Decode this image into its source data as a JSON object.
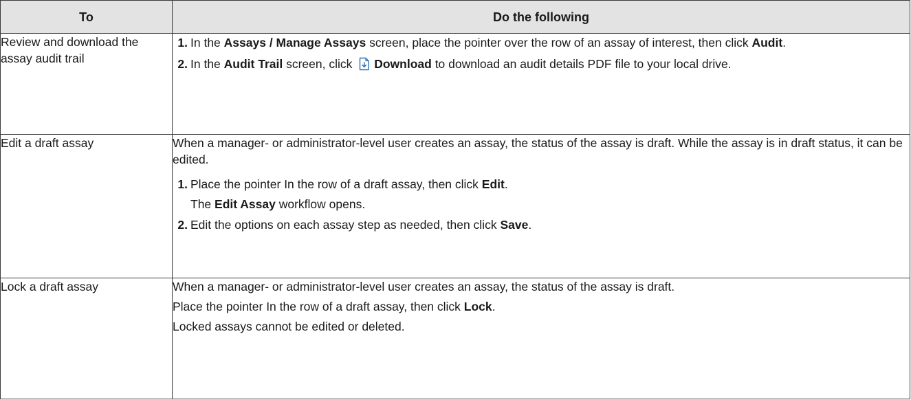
{
  "header": {
    "col1": "To",
    "col2": "Do the following"
  },
  "rows": [
    {
      "to": "Review and download the assay audit trail",
      "steps": [
        {
          "num": "1.",
          "t1": "In the ",
          "b1": "Assays / Manage Assays",
          "t2": " screen, place the pointer over the row of an assay of interest, then click ",
          "b2": "Audit",
          "t3": "."
        },
        {
          "num": "2.",
          "t1": "In the ",
          "b1": "Audit Trail",
          "t2": " screen, click ",
          "icon": "download-file-icon",
          "b2": "Download",
          "t3": " to download an audit details PDF file to your local drive."
        }
      ]
    },
    {
      "to": "Edit a draft assay",
      "intro": "When a manager- or administrator-level user creates an assay, the status of the assay is draft. While the assay is in draft status, it can be edited.",
      "steps": [
        {
          "num": "1.",
          "t1": "Place the pointer In the row of a draft assay, then click ",
          "b1": "Edit",
          "t2": ".",
          "sub_t1": "The ",
          "sub_b1": "Edit Assay",
          "sub_t2": " workflow opens."
        },
        {
          "num": "2.",
          "t1": "Edit the options on each assay step as needed, then click ",
          "b1": "Save",
          "t2": "."
        }
      ]
    },
    {
      "to": "Lock a draft assay",
      "p1": "When a manager- or administrator-level user creates an assay, the status of the assay is draft.",
      "p2_t1": "Place the pointer In the row of a draft assay, then click ",
      "p2_b1": "Lock",
      "p2_t2": ".",
      "p3": "Locked assays cannot be edited or deleted."
    }
  ],
  "colors": {
    "header_bg": "#e3e3e3",
    "border": "#3a3a3a",
    "icon_accent": "#2f6fb8"
  }
}
